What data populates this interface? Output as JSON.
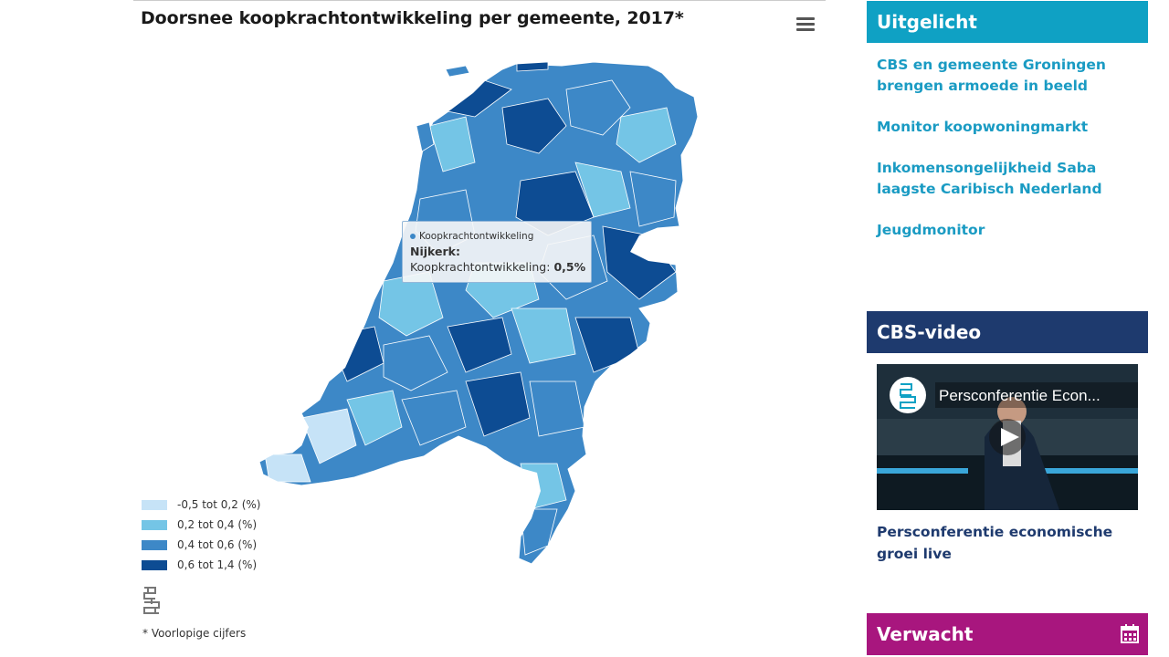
{
  "map": {
    "title": "Doorsnee koopkrachtontwikkeling per gemeente, 2017*",
    "menu_icon": "hamburger-icon",
    "tooltip": {
      "series": "Koopkrachtontwikkeling",
      "place": "Nijkerk:",
      "value_label": "Koopkrachtontwikkeling:",
      "value": "0,5%"
    },
    "legend": [
      {
        "label": "-0,5 tot 0,2 (%)",
        "color": "#c6e3f7"
      },
      {
        "label": "0,2 tot 0,4 (%)",
        "color": "#74c5e6"
      },
      {
        "label": "0,4 tot 0,6 (%)",
        "color": "#3d88c7"
      },
      {
        "label": "0,6 tot 1,4 (%)",
        "color": "#0d4c93"
      }
    ],
    "logo": "cbs-logo",
    "footnote": "* Voorlopige cijfers"
  },
  "sidebar": {
    "uitgelicht": {
      "title": "Uitgelicht",
      "links": [
        "CBS en gemeente Groningen brengen armoede in beeld",
        "Monitor koopwoningmarkt",
        "Inkomensongelijkheid Saba laagste Caribisch Nederland",
        "Jeugdmonitor"
      ]
    },
    "video": {
      "title": "CBS-video",
      "thumb_title": "Persconferentie Econ...",
      "caption": "Persconferentie economische groei live"
    },
    "verwacht": {
      "title": "Verwacht",
      "icon": "calendar-icon"
    }
  },
  "colors": {
    "teal": "#0fa1c4",
    "navy": "#1e3a6e",
    "magenta": "#a8167e",
    "link": "#1a9bc3"
  }
}
